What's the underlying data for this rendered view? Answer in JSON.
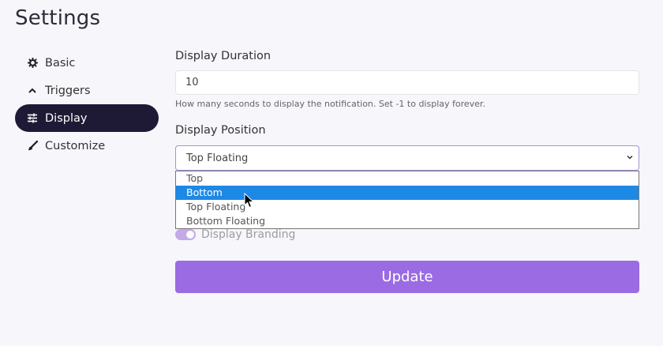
{
  "page": {
    "title": "Settings"
  },
  "colors": {
    "accent": "#9b6be3",
    "sidebar_active_bg": "#1e1a36",
    "option_highlight": "#1e88e5"
  },
  "sidebar": {
    "items": [
      {
        "label": "Basic",
        "icon": "gear-icon",
        "active": false
      },
      {
        "label": "Triggers",
        "icon": "chevron-up-icon",
        "active": false
      },
      {
        "label": "Display",
        "icon": "sliders-icon",
        "active": true
      },
      {
        "label": "Customize",
        "icon": "brush-icon",
        "active": false
      }
    ]
  },
  "form": {
    "duration": {
      "label": "Display Duration",
      "value": "10",
      "hint": "How many seconds to display the notification. Set -1 to display forever."
    },
    "position": {
      "label": "Display Position",
      "selected_value": "Top Floating",
      "highlighted_option": "Bottom",
      "options": [
        "Top",
        "Bottom",
        "Top Floating",
        "Bottom Floating"
      ]
    },
    "branding": {
      "label": "Display Branding",
      "enabled": true
    },
    "update_label": "Update"
  }
}
